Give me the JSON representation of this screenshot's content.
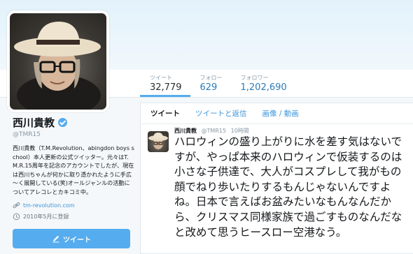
{
  "profile": {
    "name": "西川貴教",
    "handle": "@TMR15",
    "bio": "西川貴教（T.M.Revolution、abingdon boys school）本人更新の公式ツイッター。元々はT.M.R.15周年を記念のアカウントでしたが、現在は西川ちゃんが何かに取り憑かれたように手広～く展開している(笑)オールジャンルの活動についてアレコレとカキコミ中。",
    "website": "tm-revolution.com",
    "joined": "2010年5月に登録",
    "icons": {
      "verified": "verified-badge-icon",
      "link": "link-icon",
      "calendar": "calendar-icon"
    }
  },
  "stats": [
    {
      "label": "ツイート",
      "value": "32,779"
    },
    {
      "label": "フォロー",
      "value": "629"
    },
    {
      "label": "フォロワー",
      "value": "1,202,690"
    }
  ],
  "tweet_button": {
    "label": "ツイート",
    "icon": "compose-icon"
  },
  "timeline": {
    "tabs": [
      "ツイート",
      "ツイートと返信",
      "画像 / 動画"
    ],
    "tweet": {
      "name": "西川貴教",
      "handle": "@TMR15",
      "time": "10時間",
      "text": "ハロウィンの盛り上がりに水を差す気はないですが、やっぱ本来のハロウィンで仮装するのは小さな子供達で、大人がコスプレして我がもの顔でねり歩いたりするもんじゃないんですよね。日本で言えばお盆みたいなもんなんだから、クリスマス同様家族で過ごすものなんだなと改めて思うヒースロー空港なう。"
    }
  },
  "colors": {
    "accent": "#55acee",
    "link": "#3b94d9"
  }
}
